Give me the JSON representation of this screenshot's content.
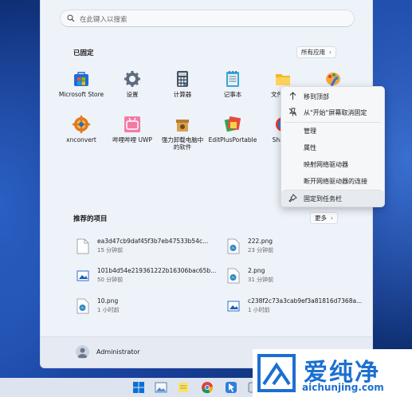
{
  "search": {
    "placeholder": "在此键入以搜索"
  },
  "pinned": {
    "title": "已固定",
    "all_apps": "所有应用",
    "apps": [
      {
        "label": "Microsoft Store",
        "icon": "store-icon"
      },
      {
        "label": "设置",
        "icon": "gear-icon"
      },
      {
        "label": "计算器",
        "icon": "calculator-icon"
      },
      {
        "label": "记事本",
        "icon": "notepad-icon"
      },
      {
        "label": "文件资源",
        "icon": "folder-icon"
      },
      {
        "label": "",
        "icon": "paint-icon"
      },
      {
        "label": "xnconvert",
        "icon": "xnconvert-icon"
      },
      {
        "label": "哔哩哔哩 UWP",
        "icon": "bilibili-icon"
      },
      {
        "label": "强力卸载电脑中\n的软件",
        "icon": "uninstall-icon"
      },
      {
        "label": "EditPlusPortable",
        "icon": "editplus-icon"
      },
      {
        "label": "ShareX",
        "icon": "sharex-icon"
      }
    ]
  },
  "recommended": {
    "title": "推荐的项目",
    "more": "更多",
    "items": [
      {
        "name": "ea3d47cb9daf45f3b7eb47533b54c...",
        "time": "15 分钟前",
        "icon": "file-icon"
      },
      {
        "name": "222.png",
        "time": "23 分钟前",
        "icon": "png-icon"
      },
      {
        "name": "101b4d54e219361222b16306bac65b...",
        "time": "50 分钟前",
        "icon": "image-icon"
      },
      {
        "name": "2.png",
        "time": "31 分钟前",
        "icon": "png-icon"
      },
      {
        "name": "10.png",
        "time": "1 小时前",
        "icon": "png-icon"
      },
      {
        "name": "c238f2c73a3cab9ef3a81816d7368a...",
        "time": "1 小时前",
        "icon": "image-icon"
      }
    ]
  },
  "user": {
    "name": "Administrator"
  },
  "context_menu": {
    "items": [
      {
        "label": "移到顶部",
        "icon": "arrow-up-icon"
      },
      {
        "label": "从\"开始\"屏幕取消固定",
        "icon": "unpin-icon"
      },
      {
        "label": "管理",
        "icon": ""
      },
      {
        "label": "属性",
        "icon": ""
      },
      {
        "label": "映射网络驱动器",
        "icon": ""
      },
      {
        "label": "断开网络驱动器的连接",
        "icon": ""
      },
      {
        "label": "固定到任务栏",
        "icon": "pin-icon"
      }
    ]
  },
  "watermark": {
    "brand": "爱纯净",
    "url": "aichunjing.com"
  },
  "colors": {
    "accent": "#0067c0",
    "watermark": "#1c6fd1"
  }
}
